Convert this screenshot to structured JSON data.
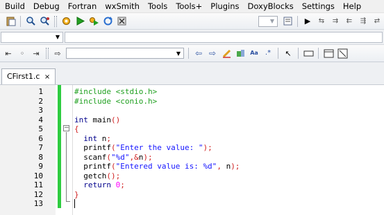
{
  "menu": [
    "Build",
    "Debug",
    "Fortran",
    "wxSmith",
    "Tools",
    "Tools+",
    "Plugins",
    "DoxyBlocks",
    "Settings",
    "Help"
  ],
  "tab": {
    "label": "CFirst1.c",
    "close": "×"
  },
  "code_lines": [
    {
      "n": "1",
      "segments": [
        {
          "t": "#include <stdio.h>",
          "c": "pp"
        }
      ]
    },
    {
      "n": "2",
      "segments": [
        {
          "t": "#include <conio.h>",
          "c": "pp"
        }
      ]
    },
    {
      "n": "3",
      "segments": []
    },
    {
      "n": "4",
      "segments": [
        {
          "t": "int",
          "c": "kw"
        },
        {
          "t": " main",
          "c": "id"
        },
        {
          "t": "()",
          "c": "op"
        }
      ]
    },
    {
      "n": "5",
      "segments": [
        {
          "t": "{",
          "c": "op"
        }
      ]
    },
    {
      "n": "6",
      "segments": [
        {
          "t": "  int",
          "c": "kw"
        },
        {
          "t": " n",
          "c": "id"
        },
        {
          "t": ";",
          "c": "op"
        }
      ]
    },
    {
      "n": "7",
      "segments": [
        {
          "t": "  printf",
          "c": "id"
        },
        {
          "t": "(",
          "c": "op"
        },
        {
          "t": "\"Enter the value: \"",
          "c": "str"
        },
        {
          "t": ");",
          "c": "op"
        }
      ]
    },
    {
      "n": "8",
      "segments": [
        {
          "t": "  scanf",
          "c": "id"
        },
        {
          "t": "(",
          "c": "op"
        },
        {
          "t": "\"%d\"",
          "c": "str"
        },
        {
          "t": ",&",
          "c": "op"
        },
        {
          "t": "n",
          "c": "id"
        },
        {
          "t": ");",
          "c": "op"
        }
      ]
    },
    {
      "n": "9",
      "segments": [
        {
          "t": "  printf",
          "c": "id"
        },
        {
          "t": "(",
          "c": "op"
        },
        {
          "t": "\"Entered value is: %d\"",
          "c": "str"
        },
        {
          "t": ", ",
          "c": "op"
        },
        {
          "t": "n",
          "c": "id"
        },
        {
          "t": ");",
          "c": "op"
        }
      ]
    },
    {
      "n": "10",
      "segments": [
        {
          "t": "  getch",
          "c": "id"
        },
        {
          "t": "();",
          "c": "op"
        }
      ]
    },
    {
      "n": "11",
      "segments": [
        {
          "t": "  return",
          "c": "kw"
        },
        {
          "t": " ",
          "c": "id"
        },
        {
          "t": "0",
          "c": "num"
        },
        {
          "t": ";",
          "c": "op"
        }
      ]
    },
    {
      "n": "12",
      "segments": [
        {
          "t": "}",
          "c": "op"
        }
      ]
    },
    {
      "n": "13",
      "segments": []
    }
  ],
  "toolbar_icons": {
    "tb1": [
      "paste-icon",
      "find-icon",
      "replace-icon",
      "build-gear-icon",
      "run-icon",
      "build-and-run-icon",
      "rebuild-icon",
      "abort-icon"
    ],
    "tb1_right": [
      "build-target-icon",
      "debug-run-icon",
      "debug-step-icon",
      "debug-step-into-icon",
      "debug-step-out-icon",
      "debug-windows-icon"
    ],
    "tb3": [
      "jump-back-icon",
      "toggle-bookmark-icon",
      "jump-forward-icon",
      "goto-icon",
      "prev-icon",
      "next-icon",
      "highlight-icon",
      "match-case-icon",
      "regex-icon",
      "select-icon",
      "rect-select-icon",
      "window-icon",
      "script-icon"
    ]
  },
  "colors": {
    "green_bar": "#2ecc40",
    "keyword": "#00008b",
    "preprocessor": "#20a020",
    "string": "#1515ff",
    "operator": "#d02020",
    "number": "#ff00ff"
  }
}
